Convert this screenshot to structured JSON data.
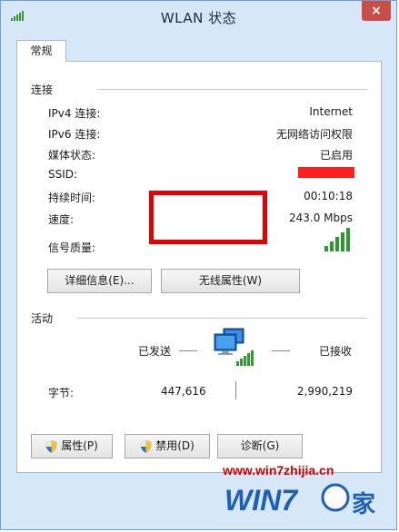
{
  "window": {
    "title": "WLAN 状态",
    "close_glyph": "×"
  },
  "tabs": [
    {
      "label": "常规"
    }
  ],
  "connection": {
    "section_label": "连接",
    "rows": [
      {
        "label": "IPv4 连接:",
        "value": "Internet"
      },
      {
        "label": "IPv6 连接:",
        "value": "无网络访问权限"
      },
      {
        "label": "媒体状态:",
        "value": "已启用"
      },
      {
        "label": "SSID:",
        "value": ""
      },
      {
        "label": "持续时间:",
        "value": "00:10:18"
      },
      {
        "label": "速度:",
        "value": "243.0 Mbps"
      },
      {
        "label": "信号质量:",
        "value": ""
      }
    ],
    "signal_quality_bars": 5,
    "details_button": "详细信息(E)...",
    "wireless_button": "无线属性(W)"
  },
  "activity": {
    "section_label": "活动",
    "sent_label": "已发送",
    "received_label": "已接收",
    "bytes_label": "字节:",
    "bytes_sent": "447,616",
    "bytes_received": "2,990,219"
  },
  "buttons": {
    "properties": "属性(P)",
    "disable": "禁用(D)",
    "diagnose": "诊断(G)"
  },
  "watermark": {
    "url": "www.win7zhijia.cn",
    "logo_text": "WIN7",
    "logo_suffix": "家"
  },
  "colors": {
    "window_frame": "#d6e8f7",
    "close_button": "#c74f48",
    "highlight": "#e60000",
    "signal_green": "#2e9b2e"
  }
}
